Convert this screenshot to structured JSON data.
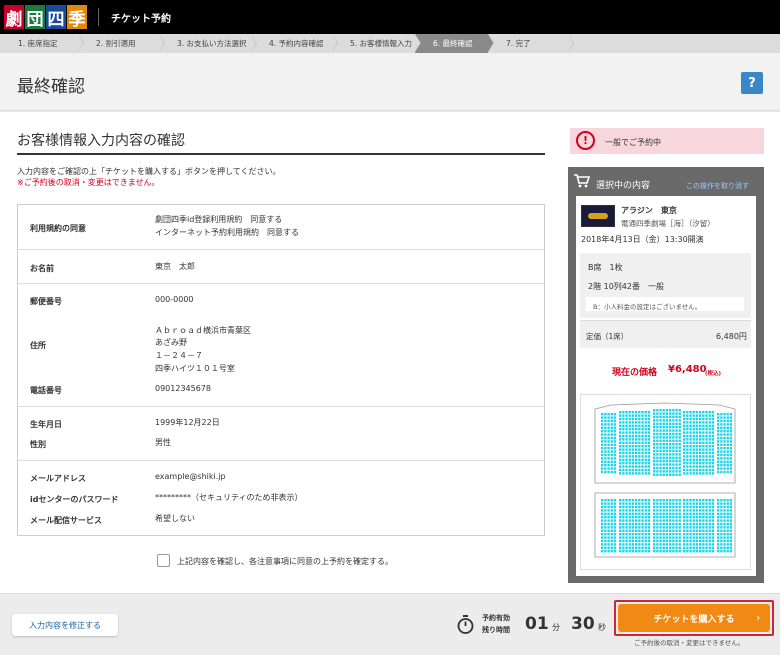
{
  "header": {
    "logo_chars": [
      "劇",
      "団",
      "四",
      "季"
    ],
    "title": "チケット予約"
  },
  "steps": [
    {
      "label": "1. 座席指定",
      "active": false
    },
    {
      "label": "2. 割引適用",
      "active": false
    },
    {
      "label": "3. お支払い方法選択",
      "active": false
    },
    {
      "label": "4. 予約内容確認",
      "active": false
    },
    {
      "label": "5. お客様情報入力",
      "active": false
    },
    {
      "label": "6. 最終確認",
      "active": true
    },
    {
      "label": "7. 完了",
      "active": false
    }
  ],
  "page": {
    "title": "最終確認",
    "help_label": "?"
  },
  "section": {
    "title": "お客様情報入力内容の確認",
    "intro": "入力内容をご確認の上「チケットを購入する」ボタンを押してください。",
    "warning": "※ご予約後の取消・変更はできません。"
  },
  "info": {
    "terms_label": "利用規約の同意",
    "terms_1": "劇団四季id登録利用規約　同意する",
    "terms_2": "インターネット予約利用規約　同意する",
    "name_label": "お名前",
    "name_value": "東京　太郎",
    "postal_label": "郵便番号",
    "postal_value": "000-0000",
    "address_label": "住所",
    "address_1": "Ａｂｒｏａｄ横浜市青葉区",
    "address_2": "あざみ野",
    "address_3": "１－２４－７",
    "address_4": "四季ハイツ１０１号室",
    "phone_label": "電話番号",
    "phone_value": "09012345678",
    "birth_label": "生年月日",
    "birth_value": "1999年12月22日",
    "gender_label": "性別",
    "gender_value": "男性",
    "email_label": "メールアドレス",
    "email_value": "example@shiki.jp",
    "password_label": "idセンターのパスワード",
    "password_value": "*********（セキュリティのため非表示）",
    "mail_label": "メール配信サービス",
    "mail_value": "希望しない"
  },
  "confirm_text": "上記内容を確認し、各注意事項に同意の上予約を確定する。",
  "panel": {
    "badge_icon": "!",
    "badge_text": "一般でご予約中",
    "title": "選択中の内容",
    "undo_link": "この操作を取り消す",
    "show_name": "アラジン　東京",
    "venue": "電通四季劇場［海］（汐留）",
    "date": "2018年4月13日（金）13:30開演",
    "seat_type": "B席　1枚",
    "seat_no": "2階 10列42番　一般",
    "note": "B：小人料金の設定はございません。",
    "price_label": "定価（1席）",
    "price_value": "6,480円",
    "current_label": "現在の価格",
    "current_value": "¥6,480",
    "tax_note": "(税込)"
  },
  "footer": {
    "edit_button": "入力内容を修正する",
    "timer_label_1": "予約有効",
    "timer_label_2": "残り時間",
    "minutes": "01",
    "minutes_unit": "分",
    "seconds": "30",
    "seconds_unit": "秒",
    "buy_button": "チケットを購入する",
    "buy_arrow": "›",
    "buy_note": "ご予約後の取消・変更はできません。"
  },
  "colors": {
    "accent_orange": "#f08a14",
    "warning_red": "#d0021b",
    "help_blue": "#3a87c8",
    "seat_cyan": "#19d3e8"
  }
}
